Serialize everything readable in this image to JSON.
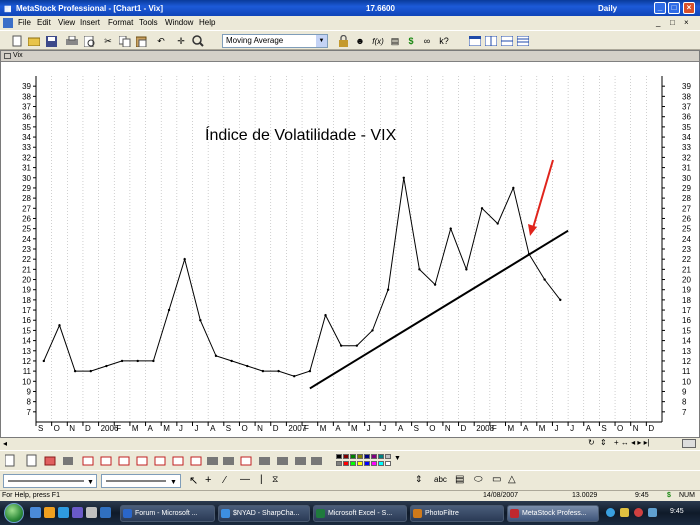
{
  "app": {
    "title": "MetaStock Professional - [Chart1 - Vix]",
    "center_value": "17.6600",
    "periodicity": "Daily",
    "window_buttons": [
      "_",
      "□",
      "×"
    ]
  },
  "menu": [
    "File",
    "Edit",
    "View",
    "Insert",
    "Format",
    "Tools",
    "Window",
    "Help"
  ],
  "toolbar": {
    "indicator_combo": "Moving Average",
    "dollar": "$",
    "formula": "f(x)"
  },
  "chart": {
    "window_label": "Vix",
    "annotation": "Índice de Volatilidade - VIX",
    "colors": {
      "line": "#000000",
      "trend": "#000000",
      "arrow": "#e0241c",
      "grid": "#b0b0b0"
    }
  },
  "chart_data": {
    "type": "line",
    "title": "Índice de Volatilidade - VIX",
    "xlabel": "",
    "ylabel": "",
    "ylim": [
      6,
      40
    ],
    "y_ticks": [
      7,
      8,
      9,
      10,
      11,
      12,
      13,
      14,
      15,
      16,
      17,
      18,
      19,
      20,
      21,
      22,
      23,
      24,
      25,
      26,
      27,
      28,
      29,
      30,
      31,
      32,
      33,
      34,
      35,
      36,
      37,
      38,
      39
    ],
    "x_tick_labels": [
      "S",
      "O",
      "N",
      "D",
      "2006",
      "F",
      "M",
      "A",
      "M",
      "J",
      "J",
      "A",
      "S",
      "O",
      "N",
      "D",
      "2007",
      "F",
      "M",
      "A",
      "M",
      "J",
      "J",
      "A",
      "S",
      "O",
      "N",
      "D",
      "2008",
      "F",
      "M",
      "A",
      "M",
      "J",
      "J",
      "A",
      "S",
      "O",
      "N",
      "D"
    ],
    "x": [
      "2005-09",
      "2005-10",
      "2005-11",
      "2005-12",
      "2006-01",
      "2006-02",
      "2006-03",
      "2006-04",
      "2006-05",
      "2006-06",
      "2006-07",
      "2006-08",
      "2006-09",
      "2006-10",
      "2006-11",
      "2006-12",
      "2007-01",
      "2007-02",
      "2007-03",
      "2007-04",
      "2007-05",
      "2007-06",
      "2007-07",
      "2007-08",
      "2007-09",
      "2007-10",
      "2007-11",
      "2007-12",
      "2008-01",
      "2008-02",
      "2008-03",
      "2008-04",
      "2008-05",
      "2008-06"
    ],
    "series": [
      {
        "values": [
          12.0,
          15.5,
          11.0,
          11.0,
          11.5,
          12.0,
          12.0,
          12.0,
          17.0,
          22.0,
          16.0,
          12.5,
          12.0,
          11.5,
          11.0,
          11.0,
          10.5,
          11.0,
          16.5,
          13.5,
          13.5,
          15.0,
          19.0,
          30.0,
          21.0,
          19.5,
          25.0,
          21.0,
          27.0,
          25.5,
          29.0,
          22.5,
          20.0,
          18.0
        ]
      }
    ],
    "trendline": {
      "from": [
        "2007-02",
        9.3
      ],
      "to": [
        "2008-07",
        24.8
      ]
    },
    "grid": true,
    "legend": "none",
    "last_value": "17.66"
  },
  "statusbar": {
    "help": "For Help, press F1",
    "date": "14/08/2007",
    "value": "13.0029",
    "time": "9:45",
    "dollar": "$",
    "num": "NUM"
  },
  "taskbar": {
    "tasks": [
      {
        "label": "Forum - Microsoft ...",
        "color": "#2a66c9"
      },
      {
        "label": "$NYAD - SharpCha...",
        "color": "#3d8fe0"
      },
      {
        "label": "Microsoft Excel - S...",
        "color": "#1f7a3d"
      },
      {
        "label": "PhotoFiltre",
        "color": "#d07a1a"
      },
      {
        "label": "MetaStock Profess...",
        "color": "#c0282e"
      }
    ],
    "clock": "9:45"
  }
}
